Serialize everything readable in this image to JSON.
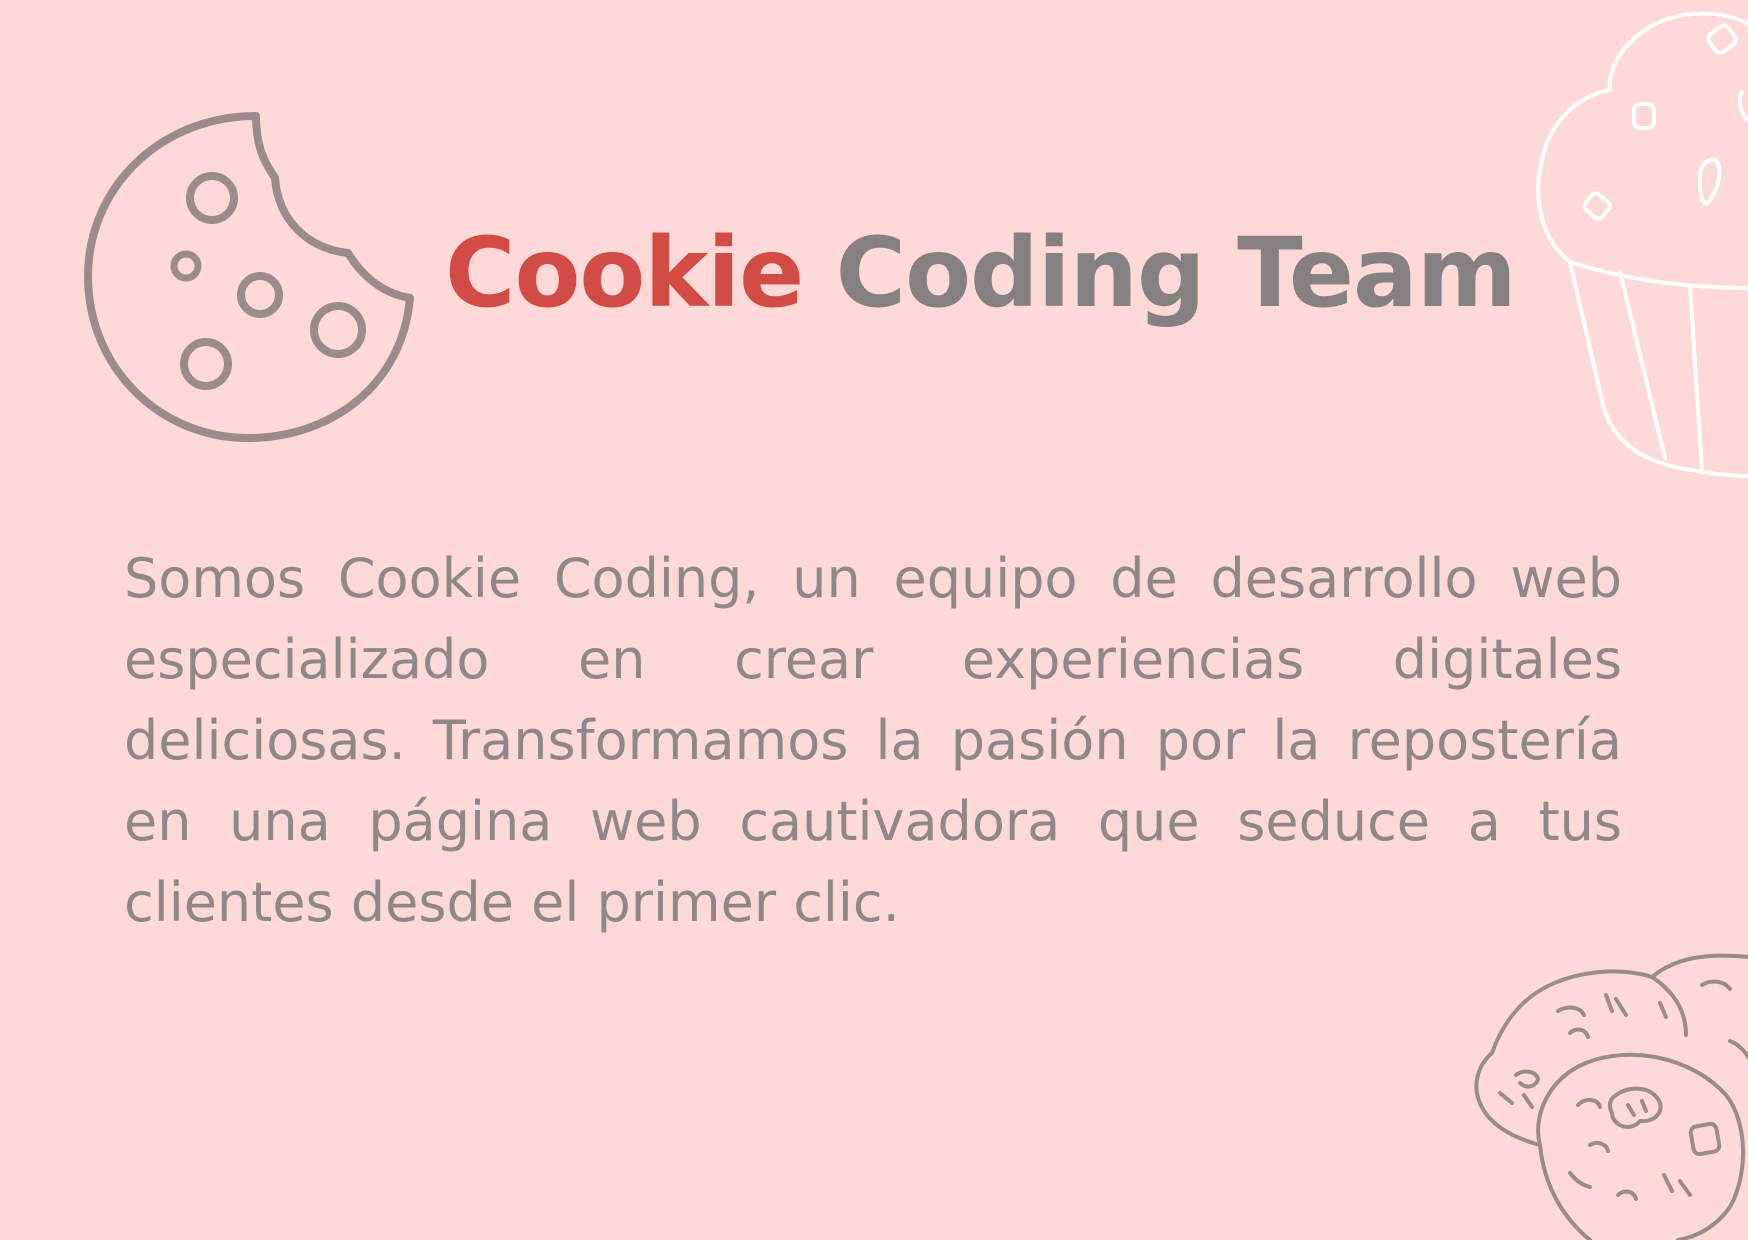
{
  "colors": {
    "background": "#FFD9D8",
    "accent": "#D24B45",
    "title_gray": "#858081",
    "text_gray": "#8E888A",
    "outline_gray": "#9A8C8D",
    "outline_white": "#FFFFFF"
  },
  "icons": {
    "logo": "bitten-cookie-icon",
    "top_right": "muffin-icon",
    "bottom_right": "cookies-icon"
  },
  "header": {
    "title_accent": "Cookie",
    "title_rest": "Coding Team"
  },
  "main": {
    "paragraph": "Somos Cookie Coding, un equipo de desarrollo web especializado en crear experiencias digitales deliciosas. Transformamos la pasión por la repostería en una página web cautivadora que seduce a tus clientes desde el primer clic."
  }
}
